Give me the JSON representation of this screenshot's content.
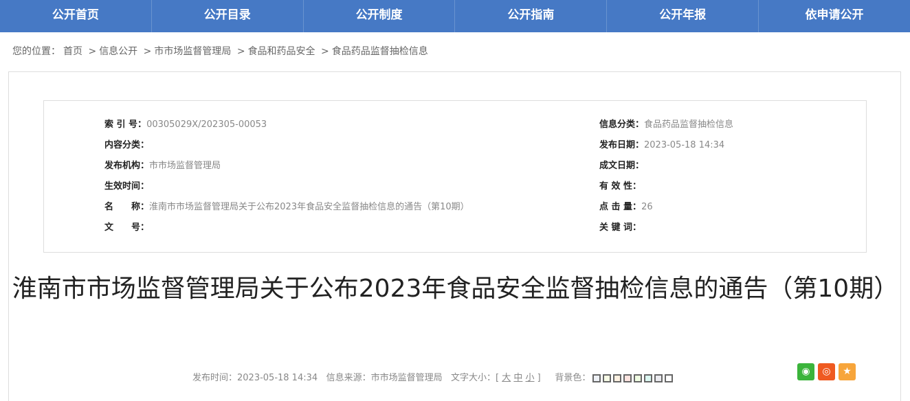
{
  "nav": [
    "公开首页",
    "公开目录",
    "公开制度",
    "公开指南",
    "公开年报",
    "依申请公开"
  ],
  "breadcrumb": {
    "prefix": "您的位置：",
    "items": [
      "首页",
      "信息公开",
      "市市场监督管理局",
      "食品和药品安全",
      "食品药品监督抽检信息"
    ],
    "sep": ">"
  },
  "meta_left": [
    {
      "label": "索 引 号：",
      "value": "00305029X/202305-00053"
    },
    {
      "label": "内容分类：",
      "value": ""
    },
    {
      "label": "发布机构：",
      "value": "市市场监督管理局"
    },
    {
      "label": "生效时间：",
      "value": ""
    },
    {
      "label": "名　　称：",
      "value": "淮南市市场监督管理局关于公布2023年食品安全监督抽检信息的通告（第10期）"
    },
    {
      "label": "文　　号：",
      "value": ""
    }
  ],
  "meta_right": [
    {
      "label": "信息分类：",
      "value": "食品药品监督抽检信息"
    },
    {
      "label": "发布日期：",
      "value": "2023-05-18 14:34"
    },
    {
      "label": "成文日期：",
      "value": ""
    },
    {
      "label": "有 效 性：",
      "value": ""
    },
    {
      "label": "点 击 量：",
      "value": "26"
    },
    {
      "label": "关 键 词：",
      "value": ""
    }
  ],
  "title": "淮南市市场监督管理局关于公布2023年食品安全监督抽检信息的通告（第10期）",
  "info": {
    "publish": "发布时间：2023-05-18 14:34",
    "source": "信息来源：市市场监督管理局",
    "font_label": "文字大小：[",
    "font_big": "大",
    "font_mid": "中",
    "font_small": "小",
    "font_end": "]",
    "bg_label": "背景色："
  },
  "bg_colors": [
    "#eef1f6",
    "#f7fbe6",
    "#fdf1e2",
    "#fde4e0",
    "#effde2",
    "#dcf8f2",
    "#ebebf0",
    "#ffffff"
  ],
  "share_colors": {
    "wechat": "#3bb43b",
    "weibo": "#ef5a20",
    "favorite": "#f7a53b"
  }
}
